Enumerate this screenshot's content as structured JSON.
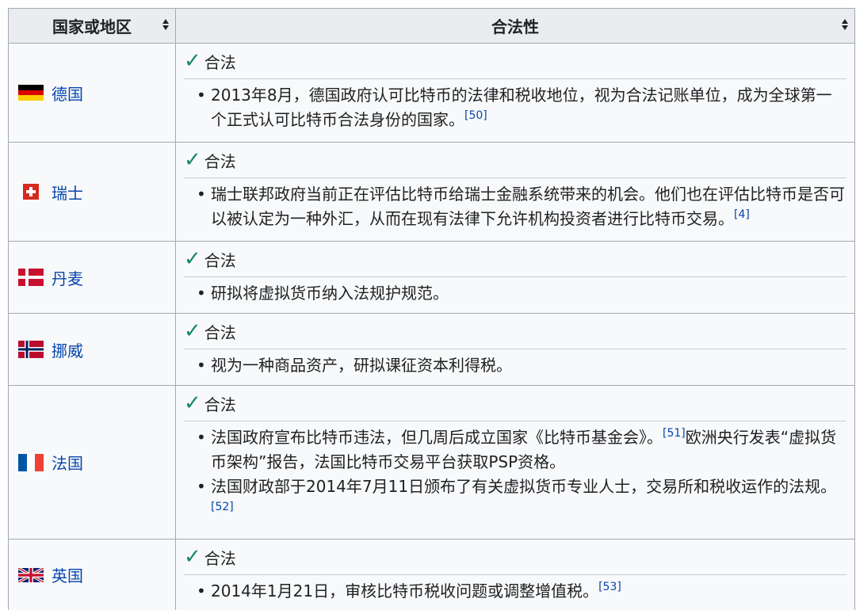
{
  "headers": {
    "country": "国家或地区",
    "legality": "合法性"
  },
  "icons": {
    "sort": "sort-icon",
    "check": "check-icon"
  },
  "rows": [
    {
      "country": "德国",
      "flag": "germany-flag-icon",
      "status": "合法",
      "notes": [
        {
          "text": "2013年8月，德国政府认可比特币的法律和税收地位，视为合法记账单位，成为全球第一个正式认可比特币合法身份的国家。",
          "ref": "[50]",
          "tail": ""
        }
      ]
    },
    {
      "country": "瑞士",
      "flag": "switzerland-flag-icon",
      "status": "合法",
      "notes": [
        {
          "text": "瑞士联邦政府当前正在评估比特币给瑞士金融系统带来的机会。他们也在评估比特币是否可以被认定为一种外汇，从而在现有法律下允许机构投资者进行比特币交易。",
          "ref": "[4]",
          "tail": ""
        }
      ]
    },
    {
      "country": "丹麦",
      "flag": "denmark-flag-icon",
      "status": "合法",
      "notes": [
        {
          "text": "研拟将虚拟货币纳入法规护规范。",
          "ref": "",
          "tail": ""
        }
      ]
    },
    {
      "country": "挪威",
      "flag": "norway-flag-icon",
      "status": "合法",
      "notes": [
        {
          "text": "视为一种商品资产，研拟课征资本利得税。",
          "ref": "",
          "tail": ""
        }
      ]
    },
    {
      "country": "法国",
      "flag": "france-flag-icon",
      "status": "合法",
      "notes": [
        {
          "text": "法国政府宣布比特币违法，但几周后成立国家《比特币基金会》。",
          "ref": "[51]",
          "tail": "欧洲央行发表“虚拟货币架构”报告，法国比特币交易平台获取PSP资格。"
        },
        {
          "text": "法国财政部于2014年7月11日颁布了有关虚拟货币专业人士，交易所和税收运作的法规。",
          "ref": "[52]",
          "tail": ""
        }
      ]
    },
    {
      "country": "英国",
      "flag": "uk-flag-icon",
      "status": "合法",
      "notes": [
        {
          "text": "2014年1月21日，审核比特币税收问题或调整增值税。",
          "ref": "[53]",
          "tail": ""
        }
      ]
    }
  ],
  "colors": {
    "link": "#0645ad",
    "check": "#14866d",
    "header_bg": "#eaecf0",
    "border": "#a2a9b1"
  }
}
